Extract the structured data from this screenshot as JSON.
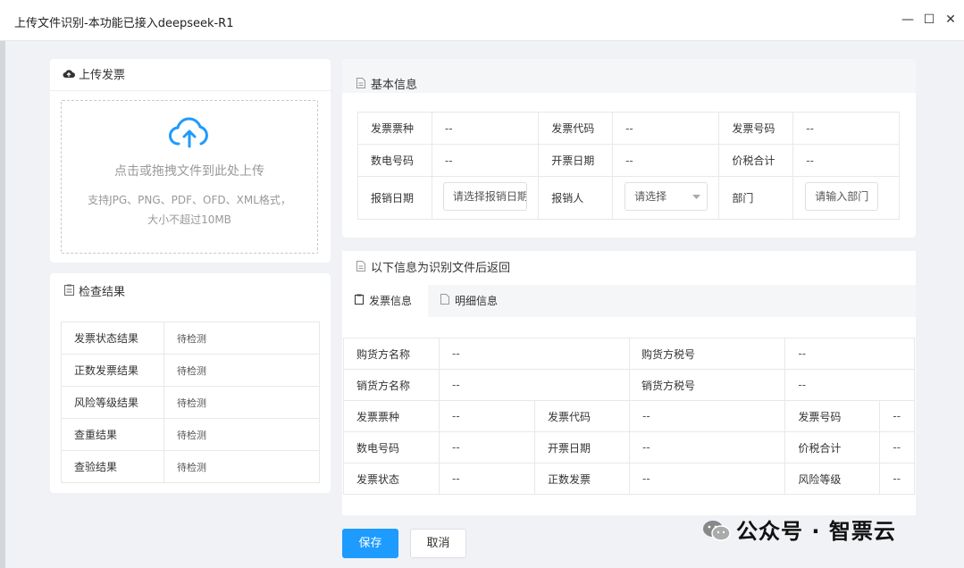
{
  "window": {
    "title": "上传文件识别-本功能已接入deepseek-R1",
    "icons": [
      "minimize-icon",
      "maximize-icon",
      "close-icon"
    ],
    "controls": {
      "minimize": "—",
      "maximize": "☐",
      "close": "✕"
    }
  },
  "upload": {
    "title": "上传发票",
    "hint_main": "点击或拖拽文件到此处上传",
    "hint_sub": "支持JPG、PNG、PDF、OFD、XML格式，大小不超过10MB",
    "accent": "#1d9bff"
  },
  "check": {
    "title": "检查结果",
    "rows": [
      {
        "label": "发票状态结果",
        "value": "待检测"
      },
      {
        "label": "正数发票结果",
        "value": "待检测"
      },
      {
        "label": "风险等级结果",
        "value": "待检测"
      },
      {
        "label": "查重结果",
        "value": "待检测"
      },
      {
        "label": "查验结果",
        "value": "待检测"
      }
    ]
  },
  "basic": {
    "title": "基本信息",
    "rows": [
      [
        {
          "k": "发票票种",
          "v": "--"
        },
        {
          "k": "发票代码",
          "v": "--"
        },
        {
          "k": "发票号码",
          "v": "--"
        }
      ],
      [
        {
          "k": "数电号码",
          "v": "--"
        },
        {
          "k": "开票日期",
          "v": "--"
        },
        {
          "k": "价税合计",
          "v": "--"
        }
      ]
    ],
    "editable": {
      "date_label": "报销日期",
      "date_placeholder": "请选择报销日期",
      "person_label": "报销人",
      "person_placeholder": "请选择",
      "dept_label": "部门",
      "dept_placeholder": "请输入部门"
    }
  },
  "recognized": {
    "title": "以下信息为识别文件后返回",
    "tabs": [
      {
        "label": "发票信息"
      },
      {
        "label": "明细信息"
      }
    ],
    "buyer_rows": [
      {
        "k1": "购货方名称",
        "v1": "--",
        "k2": "购货方税号",
        "v2": "--"
      },
      {
        "k1": "销货方名称",
        "v1": "--",
        "k2": "销货方税号",
        "v2": "--"
      }
    ],
    "rows": [
      [
        {
          "k": "发票票种",
          "v": "--"
        },
        {
          "k": "发票代码",
          "v": "--"
        },
        {
          "k": "发票号码",
          "v": "--"
        }
      ],
      [
        {
          "k": "数电号码",
          "v": "--"
        },
        {
          "k": "开票日期",
          "v": "--"
        },
        {
          "k": "价税合计",
          "v": "--"
        }
      ],
      [
        {
          "k": "发票状态",
          "v": "--"
        },
        {
          "k": "正数发票",
          "v": "--"
        },
        {
          "k": "风险等级",
          "v": "--"
        }
      ]
    ]
  },
  "footer": {
    "save": "保存",
    "cancel": "取消"
  },
  "watermark": {
    "text": "公众号 · 智票云"
  }
}
